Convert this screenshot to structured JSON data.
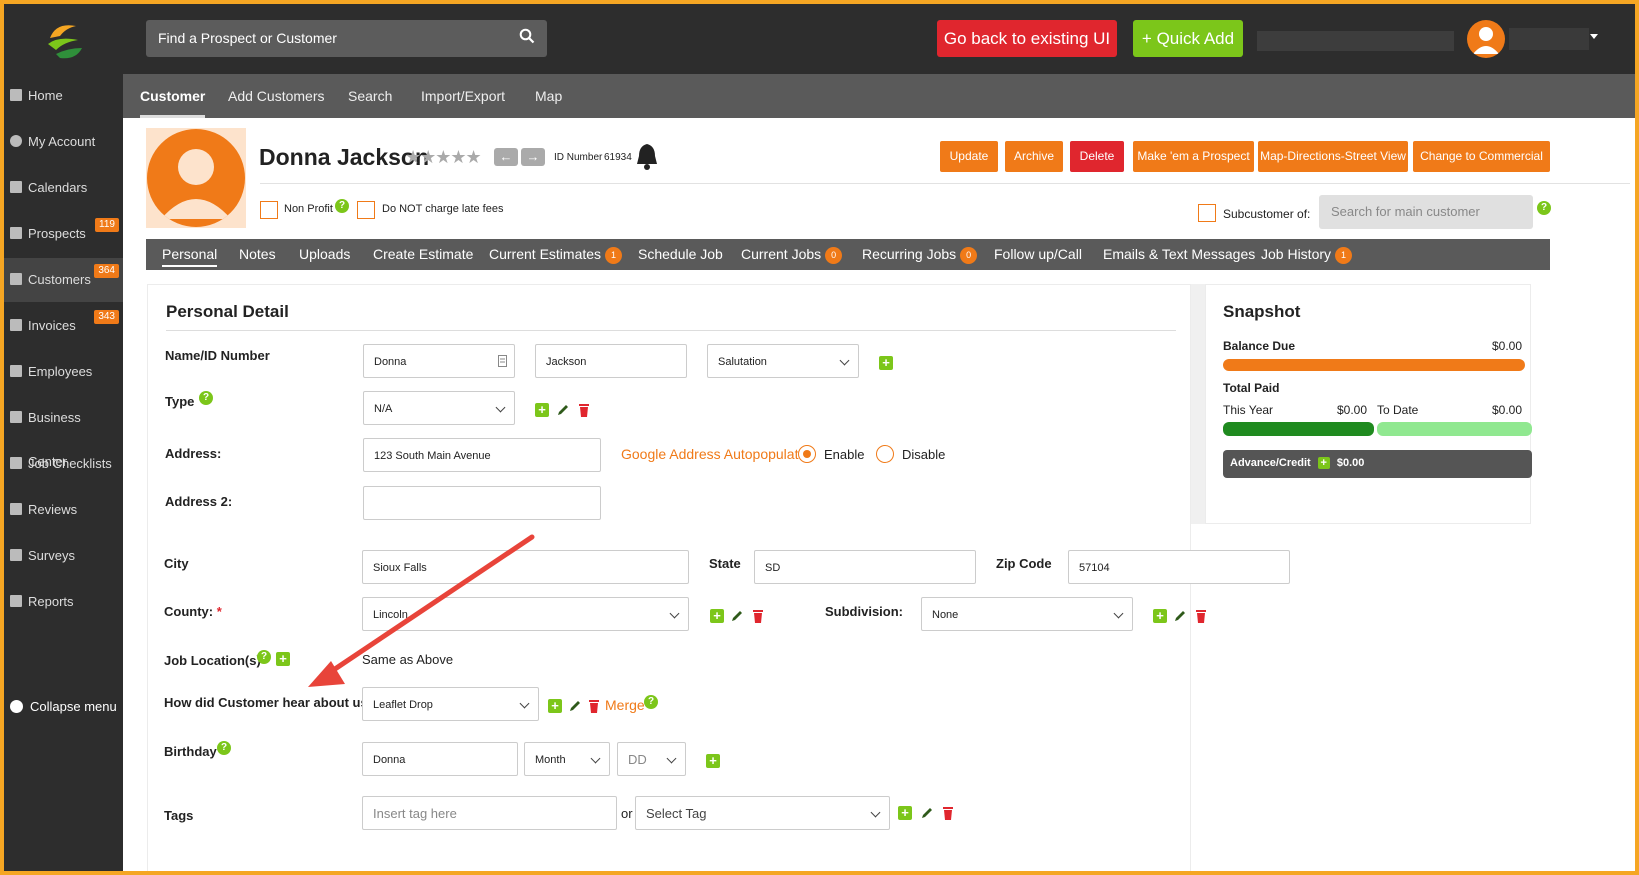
{
  "topbar": {
    "search_placeholder": "Find a Prospect or Customer",
    "back_button": "Go back to existing UI",
    "quick_add_button": "+ Quick Add"
  },
  "sidebar": {
    "items": [
      {
        "label": "Home",
        "icon": "home-icon"
      },
      {
        "label": "My Account",
        "icon": "user-icon"
      },
      {
        "label": "Calendars",
        "icon": "calendar-icon"
      },
      {
        "label": "Prospects",
        "icon": "document-icon",
        "badge": "119"
      },
      {
        "label": "Customers",
        "icon": "users-icon",
        "badge": "364"
      },
      {
        "label": "Invoices",
        "icon": "document-icon",
        "badge": "343"
      },
      {
        "label": "Employees",
        "icon": "document-icon"
      },
      {
        "label": "Business Center",
        "icon": "building-icon"
      },
      {
        "label": "Job Checklists",
        "icon": "checkbox-icon"
      },
      {
        "label": "Reviews",
        "icon": "thumbs-up-icon"
      },
      {
        "label": "Surveys",
        "icon": "list-icon"
      },
      {
        "label": "Reports",
        "icon": "clipboard-icon"
      }
    ],
    "collapse_label": "Collapse menu"
  },
  "main_tabs": [
    "Customer",
    "Add Customers",
    "Search",
    "Import/Export",
    "Map"
  ],
  "customer": {
    "name": "Donna Jackson",
    "stars": "★★★★★",
    "id_label": "ID Number",
    "id_number": "61934",
    "non_profit_label": "Non Profit",
    "no_late_fees_label": "Do NOT charge late fees",
    "subcustomer_label": "Subcustomer of:",
    "subcustomer_placeholder": "Search for main customer"
  },
  "actions": [
    "Update",
    "Archive",
    "Delete",
    "Make 'em a Prospect",
    "Map-Directions-Street View",
    "Change to Commercial"
  ],
  "subtabs": [
    {
      "label": "Personal"
    },
    {
      "label": "Notes"
    },
    {
      "label": "Uploads"
    },
    {
      "label": "Create Estimate"
    },
    {
      "label": "Current Estimates",
      "badge": "1"
    },
    {
      "label": "Schedule Job"
    },
    {
      "label": "Current Jobs",
      "badge": "0"
    },
    {
      "label": "Recurring Jobs",
      "badge": "0"
    },
    {
      "label": "Follow up/Call"
    },
    {
      "label": "Emails & Text Messages"
    },
    {
      "label": "Job History",
      "badge": "1"
    }
  ],
  "personal": {
    "title": "Personal Detail",
    "name_label": "Name/ID Number",
    "first_name": "Donna",
    "last_name": "Jackson",
    "salutation": "Salutation",
    "type_label": "Type",
    "type_value": "N/A",
    "address_label": "Address:",
    "address_value": "123 South Main Avenue",
    "google_label": "Google Address Autopopulate",
    "enable_label": "Enable",
    "disable_label": "Disable",
    "address2_label": "Address 2:",
    "city_label": "City",
    "city_value": "Sioux Falls",
    "state_label": "State",
    "state_value": "SD",
    "zip_label": "Zip Code",
    "zip_value": "57104",
    "county_label": "County:",
    "county_required": "*",
    "county_value": "Lincoln",
    "subdivision_label": "Subdivision:",
    "subdivision_value": "None",
    "job_location_label": "Job Location(s)",
    "job_location_value": "Same as Above",
    "hear_label": "How did Customer hear about us?",
    "hear_value": "Leaflet Drop",
    "merge_label": "Merge",
    "birthday_label": "Birthday",
    "birthday_value": "Donna",
    "month_value": "Month",
    "day_value": "DD",
    "tags_label": "Tags",
    "tag_placeholder": "Insert tag here",
    "or_label": "or",
    "select_tag": "Select Tag"
  },
  "snapshot": {
    "title": "Snapshot",
    "balance_label": "Balance Due",
    "balance_value": "$0.00",
    "total_paid_label": "Total Paid",
    "this_year_label": "This Year",
    "this_year_value": "$0.00",
    "to_date_label": "To Date",
    "to_date_value": "$0.00",
    "advance_label": "Advance/Credit",
    "advance_value": "$0.00"
  },
  "colors": {
    "accent_orange": "#f07a18",
    "danger_red": "#e0262e",
    "success_green": "#7cc61a",
    "dark_bg": "#2d2d2d",
    "frame_border": "#f5a623",
    "annotation_arrow": "#e8443a"
  }
}
